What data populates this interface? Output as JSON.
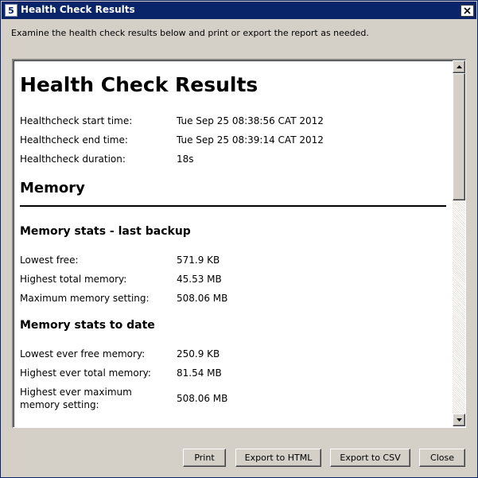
{
  "window": {
    "title": "Health Check Results",
    "app_icon_glyph": "5",
    "close_glyph": "✕"
  },
  "instructions": "Examine the health check results below and print or export the report as needed.",
  "report": {
    "title": "Health Check Results",
    "summary": [
      {
        "label": "Healthcheck start time:",
        "value": "Tue Sep 25 08:38:56 CAT 2012"
      },
      {
        "label": "Healthcheck end time:",
        "value": "Tue Sep 25 08:39:14 CAT 2012"
      },
      {
        "label": "Healthcheck duration:",
        "value": "18s"
      }
    ],
    "memory": {
      "heading": "Memory",
      "last_backup": {
        "heading": "Memory stats - last backup",
        "rows": [
          {
            "label": "Lowest free:",
            "value": "571.9 KB"
          },
          {
            "label": "Highest total memory:",
            "value": "45.53 MB"
          },
          {
            "label": "Maximum memory setting:",
            "value": "508.06 MB"
          }
        ]
      },
      "to_date": {
        "heading": "Memory stats to date",
        "rows": [
          {
            "label": "Lowest ever free memory:",
            "value": "250.9 KB"
          },
          {
            "label": "Highest ever total memory:",
            "value": "81.54 MB"
          },
          {
            "label": "Highest ever maximum memory setting:",
            "value": "508.06 MB"
          }
        ]
      }
    }
  },
  "buttons": {
    "print": "Print",
    "export_html": "Export to HTML",
    "export_csv": "Export to CSV",
    "close": "Close"
  },
  "colors": {
    "titlebar": "#0a246a",
    "window_bg": "#d4d0c8",
    "report_bg": "#ffffff"
  },
  "icons": {
    "app": "app-icon",
    "close": "close-icon",
    "scroll_up": "scroll-up-arrow-icon",
    "scroll_down": "scroll-down-arrow-icon"
  }
}
